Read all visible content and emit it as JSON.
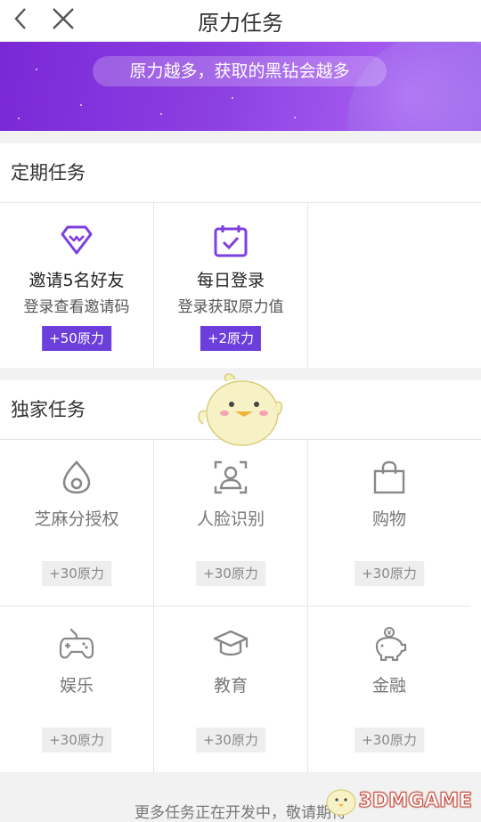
{
  "header": {
    "title": "原力任务"
  },
  "banner": {
    "text": "原力越多，获取的黑钻会越多"
  },
  "periodic": {
    "title": "定期任务",
    "items": [
      {
        "name": "邀请5名好友",
        "desc": "登录查看邀请码",
        "reward": "+50原力",
        "icon": "diamond-icon"
      },
      {
        "name": "每日登录",
        "desc": "登录获取原力值",
        "reward": "+2原力",
        "icon": "calendar-check-icon"
      }
    ]
  },
  "exclusive": {
    "title": "独家任务",
    "items": [
      {
        "name": "芝麻分授权",
        "reward": "+30原力",
        "icon": "sesame-icon"
      },
      {
        "name": "人脸识别",
        "reward": "+30原力",
        "icon": "face-scan-icon"
      },
      {
        "name": "购物",
        "reward": "+30原力",
        "icon": "shopping-bag-icon"
      },
      {
        "name": "娱乐",
        "reward": "+30原力",
        "icon": "gamepad-icon"
      },
      {
        "name": "教育",
        "reward": "+30原力",
        "icon": "graduation-cap-icon"
      },
      {
        "name": "金融",
        "reward": "+30原力",
        "icon": "piggy-bank-icon"
      }
    ]
  },
  "footer": {
    "text": "更多任务正在开发中，敬请期待"
  },
  "watermark": {
    "text": "3DMGAME"
  },
  "colors": {
    "accent": "#6c3fdc",
    "banner": "#8c3fe2",
    "badge_gray": "#eeeeee"
  }
}
